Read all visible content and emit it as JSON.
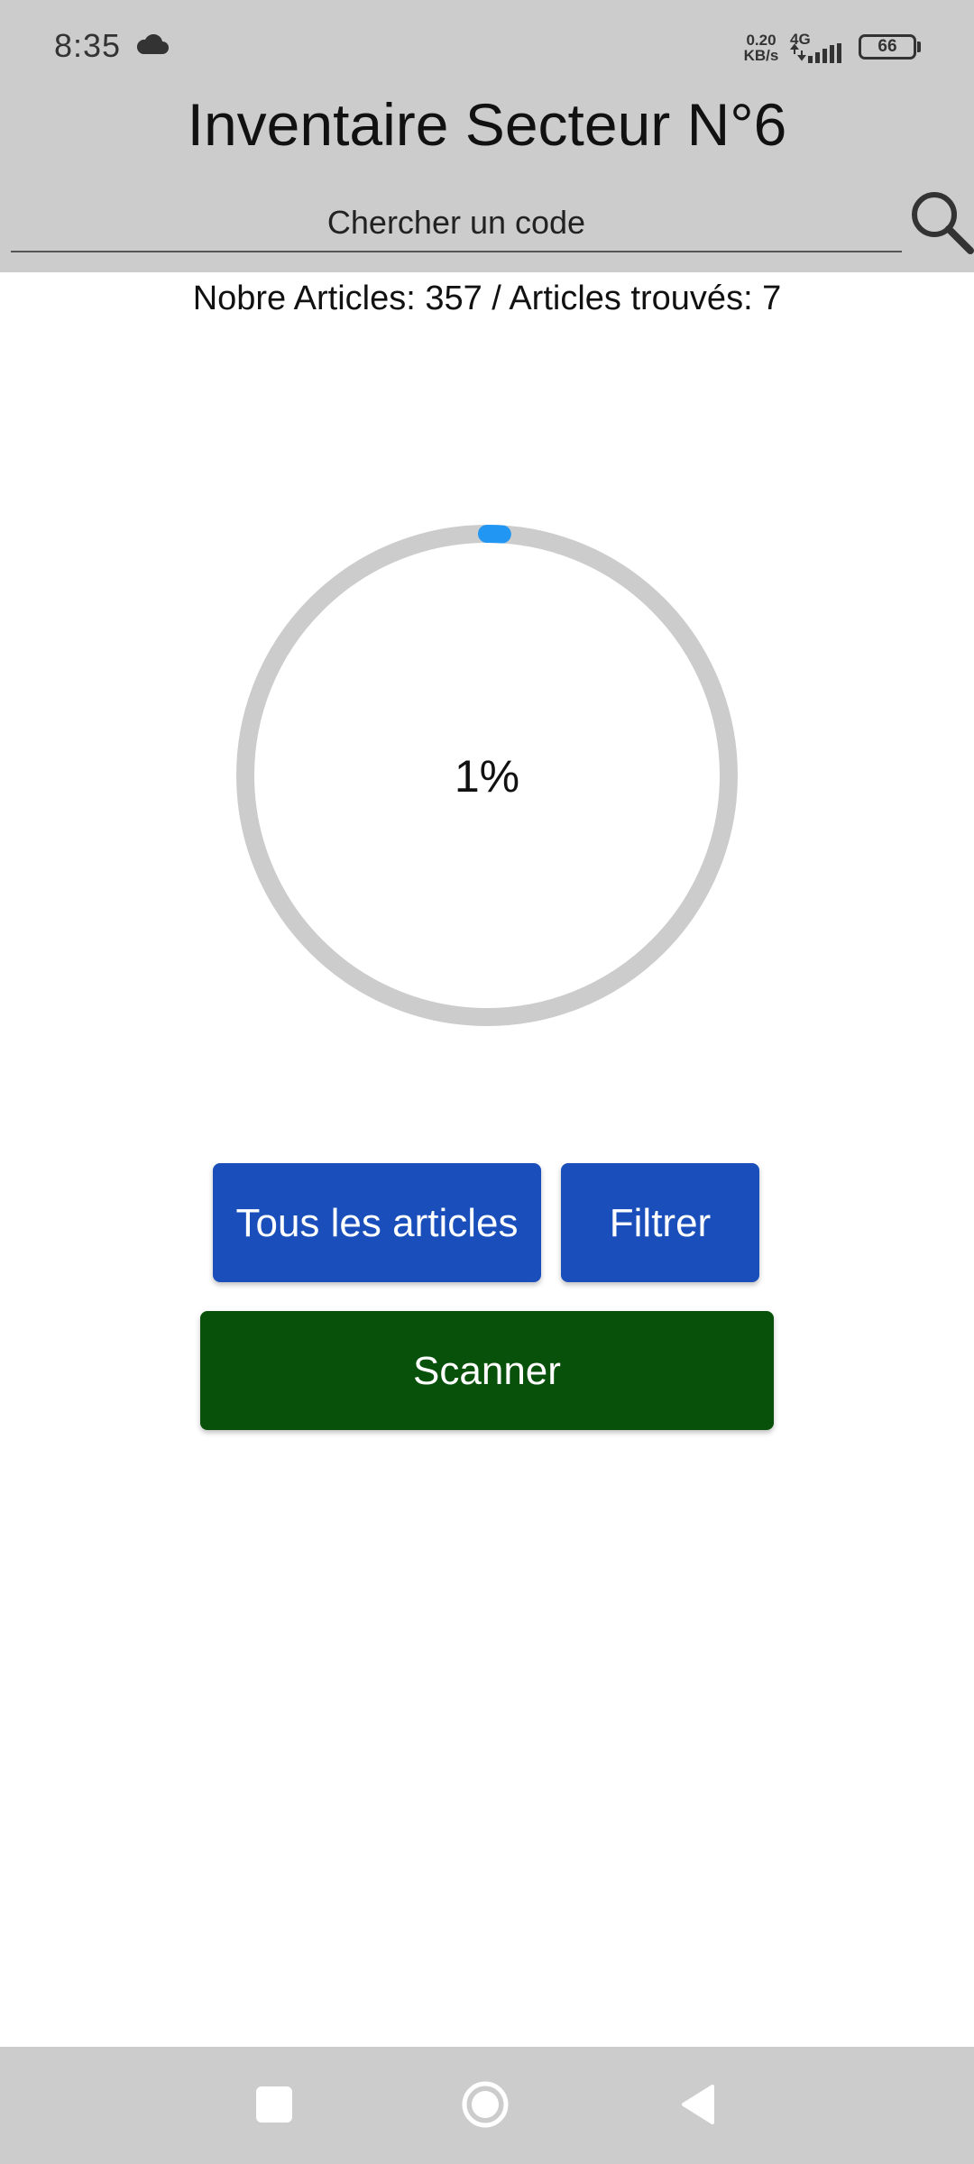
{
  "status_bar": {
    "time": "8:35",
    "net_speed_value": "0.20",
    "net_speed_unit": "KB/s",
    "network_type": "4G",
    "battery_level": "66",
    "icons": [
      "cloud-icon",
      "signal-icon",
      "battery-icon"
    ]
  },
  "header": {
    "title": "Inventaire Secteur N°6",
    "search_placeholder": "Chercher un code",
    "search_value": "",
    "search_icon": "magnifier-icon"
  },
  "summary": {
    "text": "Nobre Articles: 357 / Articles trouvés: 7",
    "total_articles": 357,
    "found_articles": 7
  },
  "progress": {
    "label": "1%",
    "percent": 1,
    "track_color": "#cccccc",
    "fill_color": "#2196f3"
  },
  "buttons": {
    "all_articles": "Tous les articles",
    "filter": "Filtrer",
    "scan": "Scanner"
  },
  "colors": {
    "header_bg": "#cccccc",
    "primary_button": "#1a4fbb",
    "scan_button": "#07510b"
  },
  "nav_bar": {
    "icons": [
      "recent-apps-icon",
      "home-icon",
      "back-icon"
    ]
  }
}
